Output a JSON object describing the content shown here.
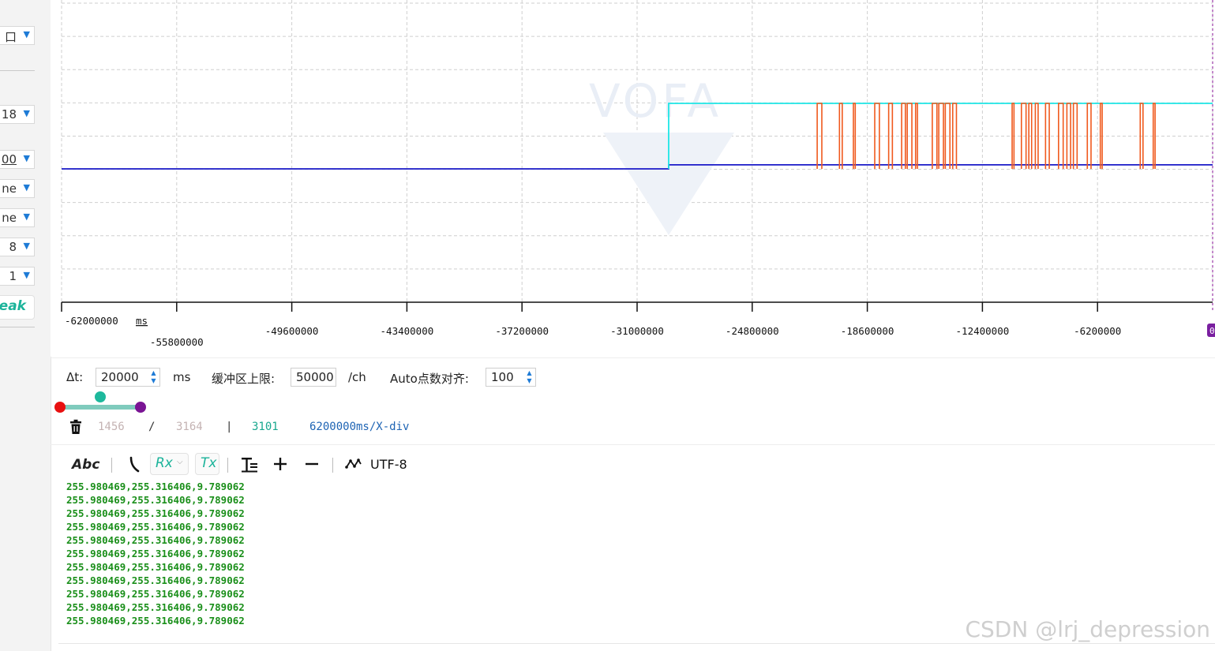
{
  "sidebar": {
    "selects": [
      {
        "value": "口",
        "underline": false
      },
      {
        "value": "18",
        "underline": false
      },
      {
        "value": "00",
        "underline": true
      },
      {
        "value": "ne",
        "underline": false
      },
      {
        "value": "ne",
        "underline": false
      },
      {
        "value": "8",
        "underline": false
      },
      {
        "value": "1",
        "underline": false
      }
    ],
    "break_label": "reak"
  },
  "chart": {
    "x_ticks": [
      -62000000,
      -55800000,
      -49600000,
      -43400000,
      -37200000,
      -31000000,
      -24800000,
      -18600000,
      -12400000,
      -6200000
    ],
    "x_tick_labels": [
      "-62000000",
      "-55800000",
      "-49600000",
      "-43400000",
      "-37200000",
      "-31000000",
      "-24800000",
      "-18600000",
      "-12400000",
      "-6200000"
    ],
    "x_unit": "ms",
    "xlim": [
      -62000000,
      0
    ],
    "watermark": "VOFA",
    "corner_label": "0",
    "grid": true
  },
  "chart_data": {
    "type": "line",
    "xlabel": "ms",
    "xlim": [
      -62000000,
      0
    ],
    "x_ticks": [
      -62000000,
      -55800000,
      -49600000,
      -43400000,
      -37200000,
      -31000000,
      -24800000,
      -18600000,
      -12400000,
      -6200000
    ],
    "grid": true,
    "series": [
      {
        "color": "#1a1ac8",
        "x": [
          -62000000,
          -29300000,
          -29300000,
          0
        ],
        "y": [
          0.0,
          0.0,
          0.05,
          0.05
        ]
      },
      {
        "color": "#1ee6e6",
        "x": [
          -29300000,
          -29300000,
          0
        ],
        "y": [
          0.0,
          1.0,
          1.0
        ]
      },
      {
        "color": "#f05a1e",
        "pulses": [
          [
            -21300000,
            -21050000
          ],
          [
            -20100000,
            -19950000
          ],
          [
            -19350000,
            -19250000
          ],
          [
            -18200000,
            -17950000
          ],
          [
            -17450000,
            -17250000
          ],
          [
            -16750000,
            -16550000
          ],
          [
            -16450000,
            -16200000
          ],
          [
            -16000000,
            -15900000
          ],
          [
            -15100000,
            -14850000
          ],
          [
            -14750000,
            -14500000
          ],
          [
            -14400000,
            -14150000
          ],
          [
            -14000000,
            -13800000
          ],
          [
            -10800000,
            -10700000
          ],
          [
            -10300000,
            -10050000
          ],
          [
            -9900000,
            -9750000
          ],
          [
            -9550000,
            -9400000
          ],
          [
            -9000000,
            -8800000
          ],
          [
            -8300000,
            -8050000
          ],
          [
            -7850000,
            -7650000
          ],
          [
            -7500000,
            -7300000
          ],
          [
            -6750000,
            -6550000
          ],
          [
            -6050000,
            -5950000
          ],
          [
            -3900000,
            -3750000
          ],
          [
            -3200000,
            -3100000
          ]
        ],
        "low": 0.0,
        "high": 1.0
      }
    ]
  },
  "controls": {
    "dt_label": "Δt:",
    "dt_value": "20000",
    "dt_unit": "ms",
    "buffer_label": "缓冲区上限:",
    "buffer_value": "50000",
    "buffer_unit": "/ch",
    "auto_label": "Auto点数对齐:",
    "auto_value": "100"
  },
  "slider": {
    "start": 0.0,
    "mid": 0.5,
    "end": 1.0
  },
  "status": {
    "count_a": "1456",
    "slash": "/",
    "count_b": "3164",
    "pipe": "|",
    "count_c": "3101",
    "scale": "6200000ms/X-div"
  },
  "toolbar": {
    "abc": "Abc",
    "rx": "Rx",
    "tx": "Tx",
    "encoding": "UTF-8"
  },
  "log": [
    "255.980469,255.316406,9.789062",
    "255.980469,255.316406,9.789062",
    "255.980469,255.316406,9.789062",
    "255.980469,255.316406,9.789062",
    "255.980469,255.316406,9.789062",
    "255.980469,255.316406,9.789062",
    "255.980469,255.316406,9.789062",
    "255.980469,255.316406,9.789062",
    "255.980469,255.316406,9.789062",
    "255.980469,255.316406,9.789062",
    "255.980469,255.316406,9.789062"
  ],
  "watermark_text": "CSDN @lrj_depression"
}
